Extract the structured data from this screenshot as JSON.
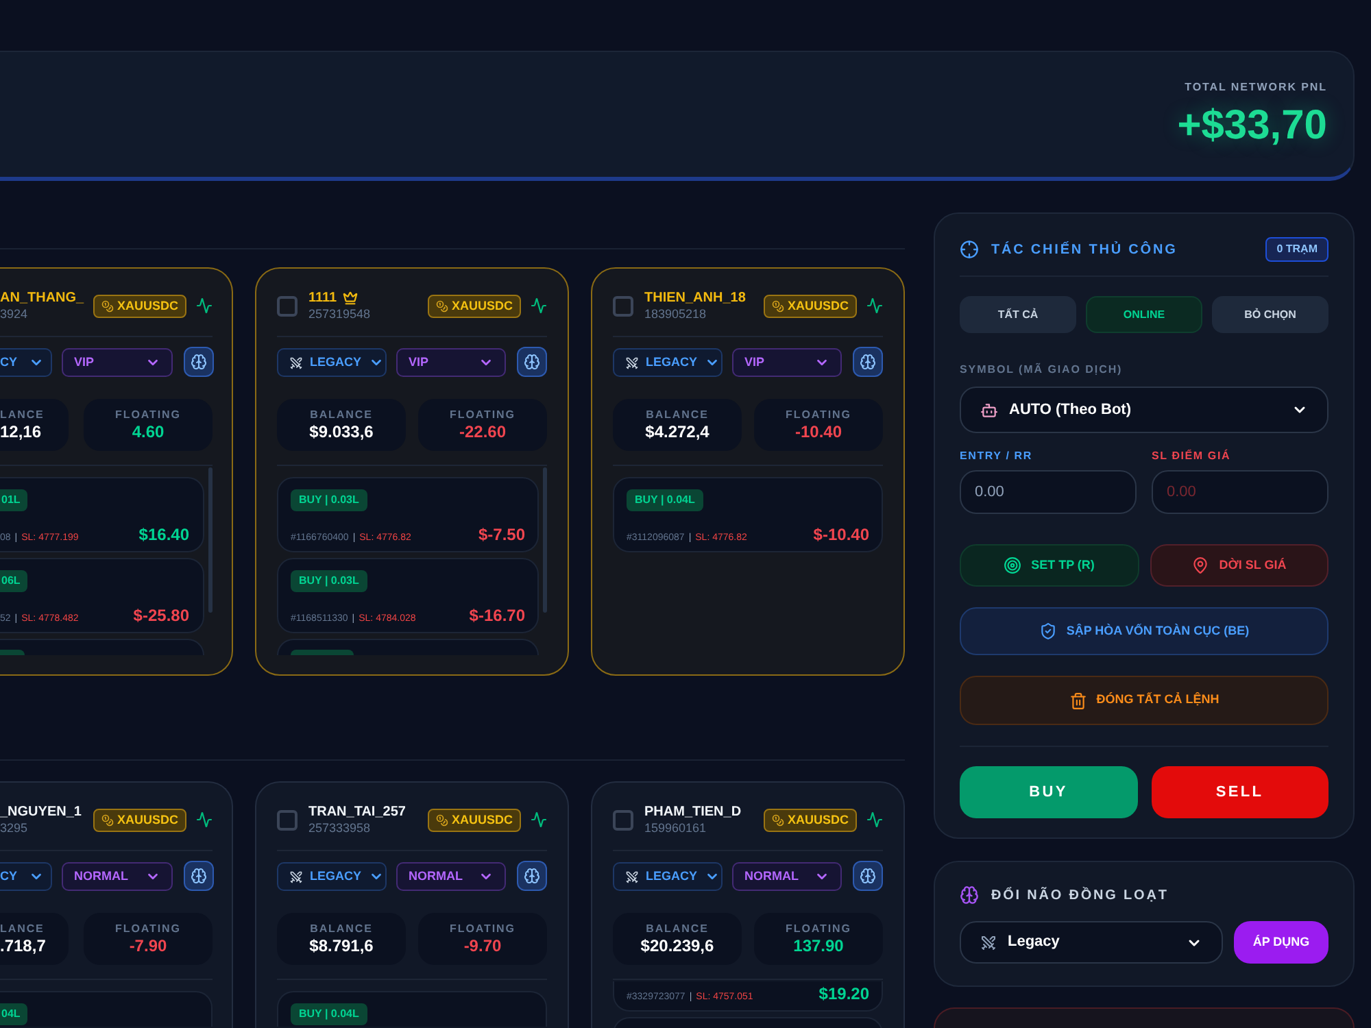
{
  "header": {
    "pnl_label": "TOTAL NETWORK PNL",
    "pnl_value": "+$33,70",
    "positive": true
  },
  "accounts": {
    "rows": [
      {
        "edge_card": {
          "name": "AN_THANG_",
          "account_id": "3924",
          "highlighted": true,
          "symbol": "XAUUSDC",
          "strategy": "CY",
          "tier": "VIP",
          "balance_label": "LANCE",
          "balance": "12,16",
          "floating_label": "FLOATING",
          "floating": "4.60",
          "floating_positive": true,
          "scrollable": true,
          "orders": [
            {
              "kind": "full",
              "side_lot": "01L",
              "ticket": "08",
              "separator": "|",
              "sl": "SL: 4777.199",
              "pnl": "$16.40",
              "positive": true
            },
            {
              "kind": "full",
              "side_lot": "06L",
              "ticket": "52",
              "separator": "|",
              "sl": "SL: 4778.482",
              "pnl": "$-25.80",
              "positive": false
            },
            {
              "kind": "stub"
            }
          ]
        },
        "cards": [
          {
            "name": "1111",
            "crown": true,
            "account_id": "257319548",
            "highlighted": true,
            "checked": false,
            "symbol": "XAUUSDC",
            "strategy": "LEGACY",
            "tier": "VIP",
            "balance_label": "BALANCE",
            "balance": "$9.033,6",
            "floating_label": "FLOATING",
            "floating": "-22.60",
            "floating_positive": false,
            "scrollable": true,
            "orders": [
              {
                "kind": "full",
                "side_lot": "BUY | 0.03L",
                "ticket": "#1166760400",
                "separator": "|",
                "sl": "SL: 4776.82",
                "pnl": "$-7.50",
                "positive": false
              },
              {
                "kind": "full",
                "side_lot": "BUY | 0.03L",
                "ticket": "#1168511330",
                "separator": "|",
                "sl": "SL: 4784.028",
                "pnl": "$-16.70",
                "positive": false
              },
              {
                "kind": "stub"
              }
            ]
          },
          {
            "name": "THIEN_ANH_18",
            "crown": false,
            "account_id": "183905218",
            "highlighted": true,
            "checked": false,
            "symbol": "XAUUSDC",
            "strategy": "LEGACY",
            "tier": "VIP",
            "balance_label": "BALANCE",
            "balance": "$4.272,4",
            "floating_label": "FLOATING",
            "floating": "-10.40",
            "floating_positive": false,
            "scrollable": false,
            "orders": [
              {
                "kind": "full",
                "side_lot": "BUY | 0.04L",
                "ticket": "#3112096087",
                "separator": "|",
                "sl": "SL: 4776.82",
                "pnl": "$-10.40",
                "positive": false
              }
            ]
          }
        ]
      },
      {
        "edge_card": {
          "name": "_NGUYEN_1",
          "account_id": "3295",
          "highlighted": false,
          "symbol": "XAUUSDC",
          "strategy": "CY",
          "tier": "NORMAL",
          "balance_label": "LANCE",
          "balance": ".718,7",
          "floating_label": "FLOATING",
          "floating": "-7.90",
          "floating_positive": false,
          "scrollable": false,
          "orders": [
            {
              "kind": "head",
              "side_lot": "04L"
            }
          ]
        },
        "cards": [
          {
            "name": "TRAN_TAI_257",
            "crown": false,
            "account_id": "257333958",
            "highlighted": false,
            "checked": false,
            "symbol": "XAUUSDC",
            "strategy": "LEGACY",
            "tier": "NORMAL",
            "balance_label": "BALANCE",
            "balance": "$8.791,6",
            "floating_label": "FLOATING",
            "floating": "-9.70",
            "floating_positive": false,
            "scrollable": false,
            "orders": [
              {
                "kind": "head",
                "side_lot": "BUY | 0.04L"
              }
            ]
          },
          {
            "name": "PHAM_TIEN_D",
            "crown": false,
            "account_id": "159960161",
            "highlighted": false,
            "checked": false,
            "symbol": "XAUUSDC",
            "strategy": "LEGACY",
            "tier": "NORMAL",
            "balance_label": "BALANCE",
            "balance": "$20.239,6",
            "floating_label": "FLOATING",
            "floating": "137.90",
            "floating_positive": true,
            "scrollable": false,
            "orders": [
              {
                "kind": "tail",
                "ticket": "#3329723077",
                "separator": "|",
                "sl": "SL: 4757.051",
                "pnl": "$19.20",
                "positive": true
              },
              {
                "kind": "stub"
              }
            ]
          }
        ]
      }
    ]
  },
  "manual_panel": {
    "title": "TÁC CHIẾN THỦ CÔNG",
    "stations_badge": "0 TRẠM",
    "filters": [
      {
        "label": "TẤT CẢ",
        "kind": "neutral"
      },
      {
        "label": "ONLINE",
        "kind": "online"
      },
      {
        "label": "BỎ CHỌN",
        "kind": "neutral"
      }
    ],
    "symbol_label": "SYMBOL (MÃ GIAO DỊCH)",
    "symbol_value": "AUTO (Theo Bot)",
    "entry_label": "ENTRY / RR",
    "entry_placeholder": "0.00",
    "sl_label": "SL ĐIỂM GIÁ",
    "sl_placeholder": "0.00",
    "actions": [
      {
        "label": "SET TP (R)",
        "kind": "tp"
      },
      {
        "label": "DỜI SL GIÁ",
        "kind": "sl"
      },
      {
        "label": "SẬP HÒA VỐN TOÀN CỤC (BE)",
        "kind": "breakeven"
      },
      {
        "label": "ĐÓNG TẤT CẢ LỆNH",
        "kind": "close_all"
      }
    ],
    "buy": "BUY",
    "sell": "SELL"
  },
  "brain_panel": {
    "title": "ĐỔI NÃO ĐỒNG LOẠT",
    "strategy_value": "Legacy",
    "apply": "ÁP DỤNG"
  }
}
